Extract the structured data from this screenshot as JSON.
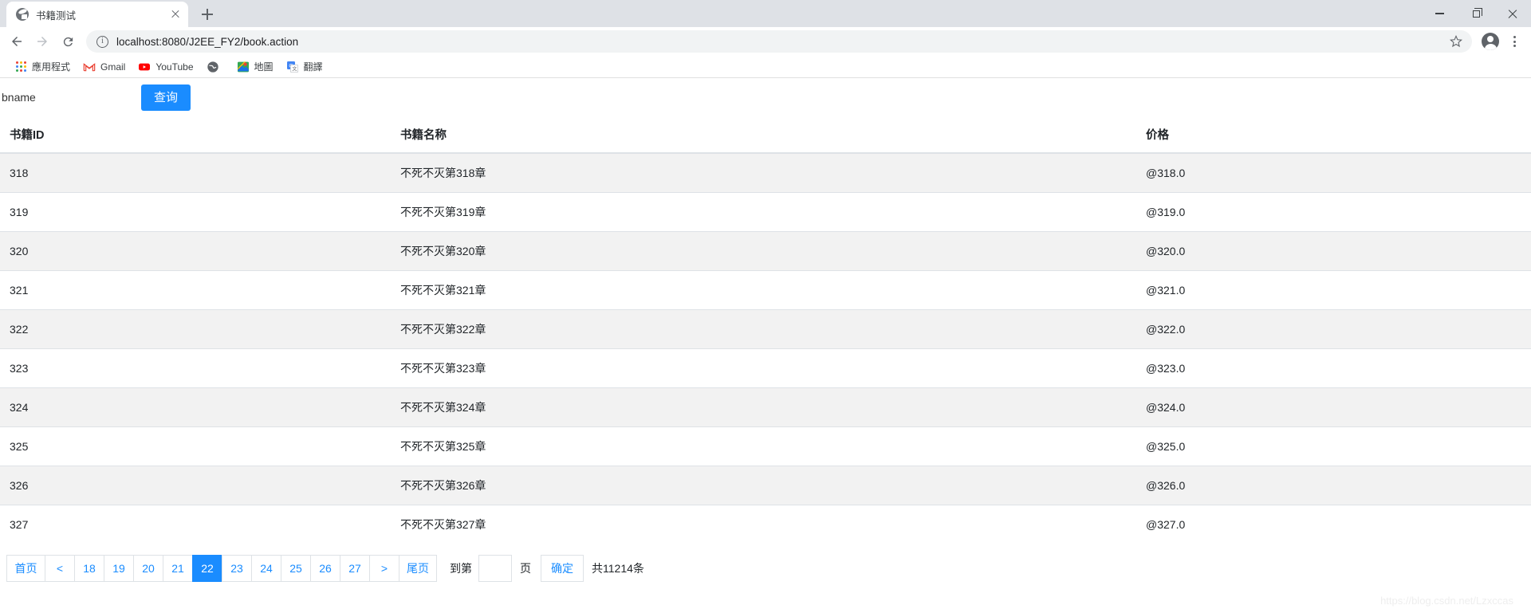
{
  "browser": {
    "tab": {
      "title": "书籍测试",
      "favicon": "globe-icon",
      "close": "×"
    },
    "newtab_tooltip": "+",
    "window_controls": {
      "minimize": "—",
      "maximize": "❐",
      "close": "✕"
    },
    "toolbar": {
      "back": "back-arrow-icon",
      "forward": "forward-arrow-icon",
      "reload": "reload-icon",
      "site_info": "info-icon",
      "url": "localhost:8080/J2EE_FY2/book.action",
      "bookmark_star": "star-icon",
      "profile": "avatar-icon",
      "menu": "kebab-menu-icon"
    },
    "bookmarks": [
      {
        "label": "應用程式",
        "icon": "apps-grid-icon"
      },
      {
        "label": "Gmail",
        "icon": "gmail-icon"
      },
      {
        "label": "YouTube",
        "icon": "youtube-icon"
      },
      {
        "label": "",
        "icon": "globe-icon"
      },
      {
        "label": "地圖",
        "icon": "maps-icon"
      },
      {
        "label": "翻譯",
        "icon": "translate-icon"
      }
    ]
  },
  "search": {
    "input_value": "bname",
    "input_placeholder": "bname",
    "button_label": "查询"
  },
  "table": {
    "headers": [
      "书籍ID",
      "书籍名称",
      "价格"
    ],
    "rows": [
      {
        "id": "318",
        "name": "不死不灭第318章",
        "price": "@318.0"
      },
      {
        "id": "319",
        "name": "不死不灭第319章",
        "price": "@319.0"
      },
      {
        "id": "320",
        "name": "不死不灭第320章",
        "price": "@320.0"
      },
      {
        "id": "321",
        "name": "不死不灭第321章",
        "price": "@321.0"
      },
      {
        "id": "322",
        "name": "不死不灭第322章",
        "price": "@322.0"
      },
      {
        "id": "323",
        "name": "不死不灭第323章",
        "price": "@323.0"
      },
      {
        "id": "324",
        "name": "不死不灭第324章",
        "price": "@324.0"
      },
      {
        "id": "325",
        "name": "不死不灭第325章",
        "price": "@325.0"
      },
      {
        "id": "326",
        "name": "不死不灭第326章",
        "price": "@326.0"
      },
      {
        "id": "327",
        "name": "不死不灭第327章",
        "price": "@327.0"
      }
    ]
  },
  "pagination": {
    "first_label": "首页",
    "prev_label": "<",
    "pages": [
      "18",
      "19",
      "20",
      "21",
      "22",
      "23",
      "24",
      "25",
      "26",
      "27"
    ],
    "active_page": "22",
    "next_label": ">",
    "last_label": "尾页",
    "goto_prefix": "到第",
    "goto_value": "",
    "goto_suffix": "页",
    "confirm_label": "确定",
    "total_text": "共11214条"
  },
  "watermark": "https://blog.csdn.net/Lzxccas",
  "colors": {
    "accent": "#1a8cff",
    "link": "#1a8cff",
    "stripe": "#f2f2f2",
    "border": "#dee2e6",
    "tabstrip": "#dee1e6"
  }
}
